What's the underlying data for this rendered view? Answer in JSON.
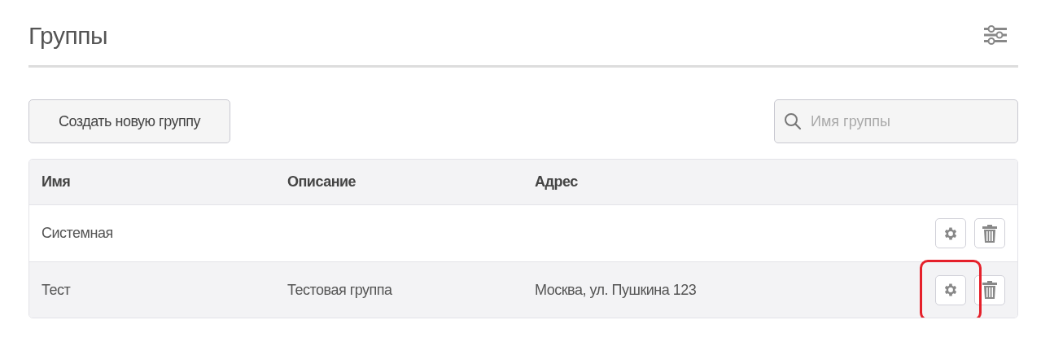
{
  "header": {
    "title": "Группы"
  },
  "toolbar": {
    "create_button": "Создать новую группу",
    "search": {
      "placeholder": "Имя группы"
    }
  },
  "table": {
    "columns": [
      "Имя",
      "Описание",
      "Адрес"
    ],
    "rows": [
      {
        "cells": [
          "Системная",
          "",
          ""
        ],
        "hovered": false,
        "settings_highlighted": false
      },
      {
        "cells": [
          "Тест",
          "Тестовая группа",
          "Москва, ул. Пушкина 123"
        ],
        "hovered": true,
        "settings_highlighted": true
      }
    ]
  }
}
